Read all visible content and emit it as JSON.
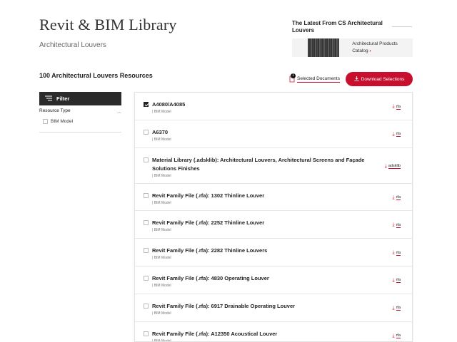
{
  "header": {
    "title": "Revit & BIM Library",
    "subtitle": "Architectural Louvers"
  },
  "latest": {
    "title": "The Latest From CS Architectural Louvers",
    "card_text": "Architectural Products Catalog",
    "card_chevron": "›"
  },
  "results": {
    "count_label": "100 Architectural Louvers Resources",
    "selected_count": "1",
    "selected_label": "Selected Documents",
    "download_label": "Download Selections"
  },
  "filter": {
    "label": "Filter",
    "facet_title": "Resource Type",
    "facet_option": "BIM Model"
  },
  "items": [
    {
      "title": "A4080/A4085",
      "meta": "| BIM Model",
      "ext": "rfa",
      "checked": true
    },
    {
      "title": "A6370",
      "meta": "| BIM Model",
      "ext": "rfa",
      "checked": false
    },
    {
      "title": "Material Library (.adsklib): Architectural Louvers, Architectural Screens and Façade Solutions Finishes",
      "meta": "| BIM Model",
      "ext": "adsklib",
      "checked": false
    },
    {
      "title": "Revit Family File (.rfa): 1302 Thinline Louver",
      "meta": "| BIM Model",
      "ext": "rfa",
      "checked": false
    },
    {
      "title": "Revit Family File (.rfa): 2252 Thinline Louver",
      "meta": "| BIM Model",
      "ext": "rfa",
      "checked": false
    },
    {
      "title": "Revit Family File (.rfa): 2282 Thinline Louvers",
      "meta": "| BIM Model",
      "ext": "rfa",
      "checked": false
    },
    {
      "title": "Revit Family File (.rfa): 4830 Operating Louver",
      "meta": "| BIM Model",
      "ext": "rfa",
      "checked": false
    },
    {
      "title": "Revit Family File (.rfa): 6917 Drainable Operating Louver",
      "meta": "| BIM Model",
      "ext": "rfa",
      "checked": false
    },
    {
      "title": "Revit Family File (.rfa): A12350 Acoustical Louver",
      "meta": "| BIM Model",
      "ext": "rfa",
      "checked": false
    }
  ],
  "colors": {
    "accent": "#c8102e",
    "filter_bar": "#2b2b2b"
  }
}
